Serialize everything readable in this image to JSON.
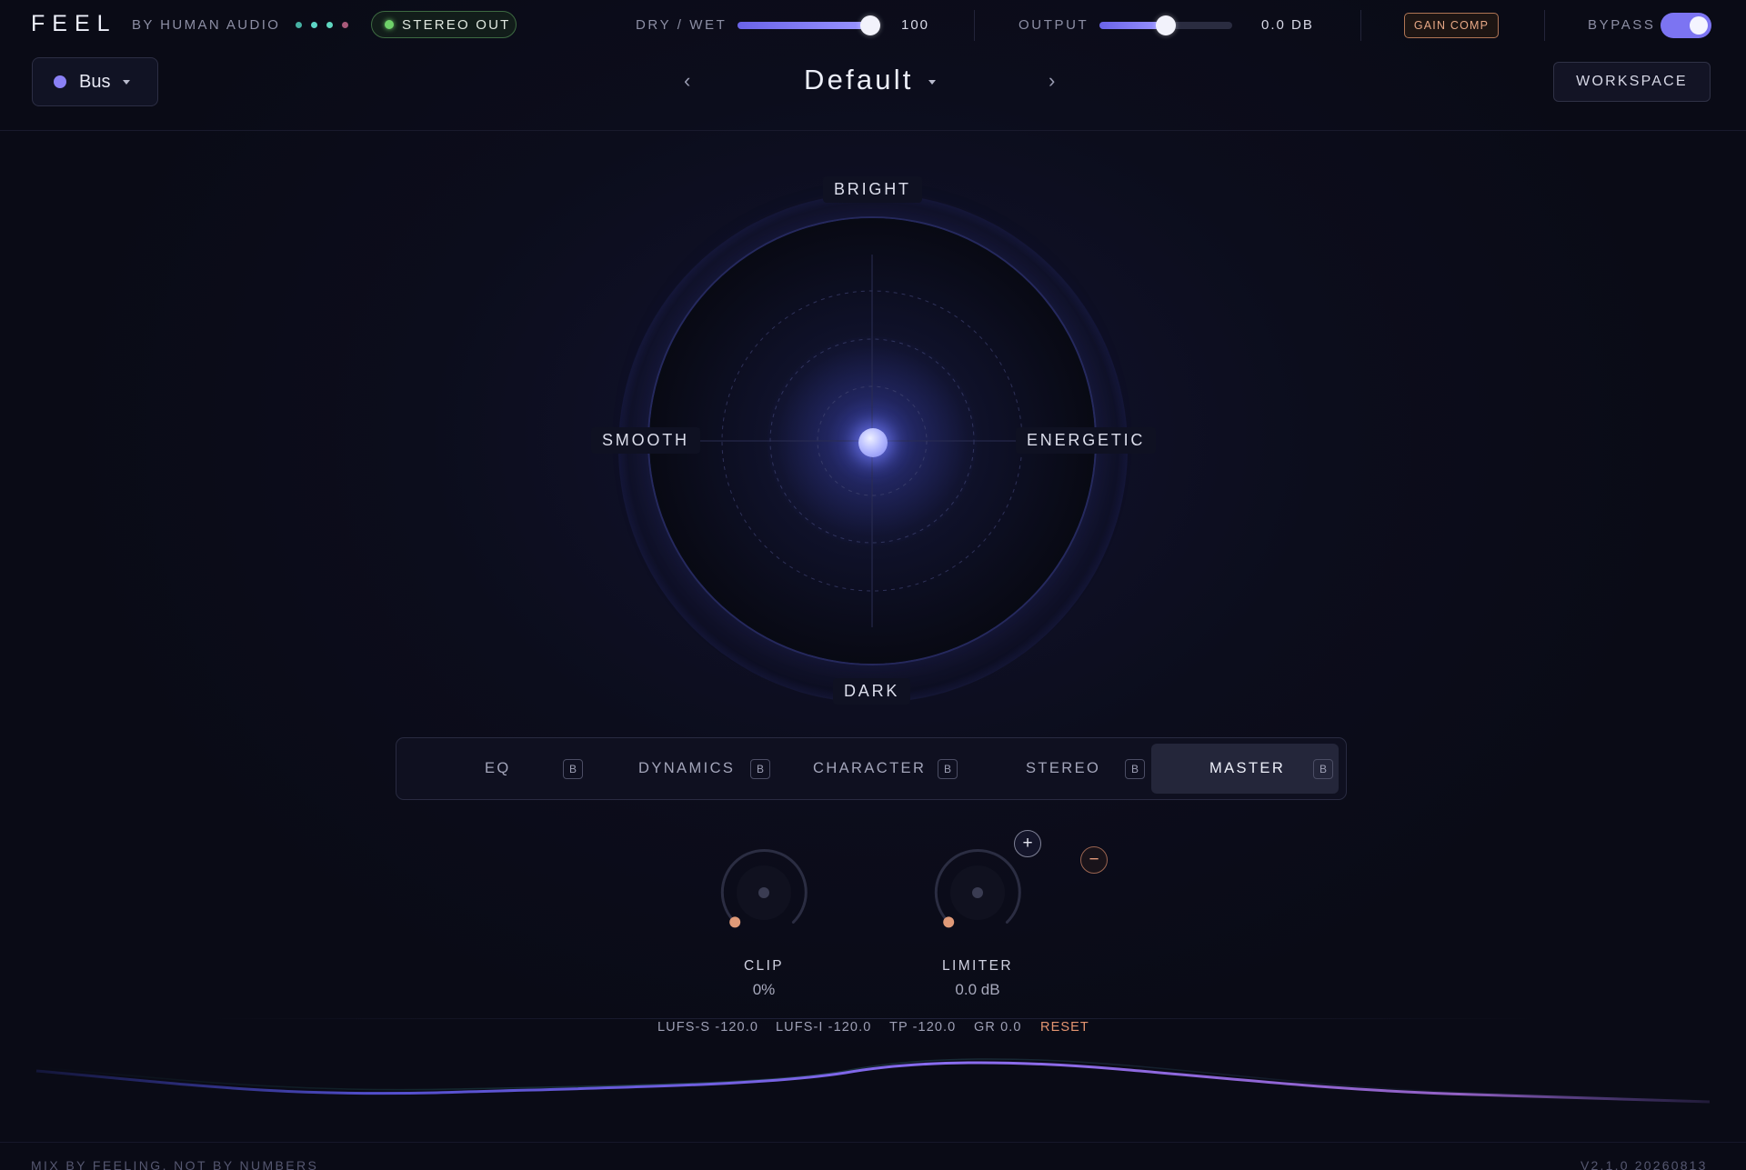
{
  "header": {
    "brand": "FEEL",
    "brand_sub": "BY HUMAN AUDIO",
    "status_dots": [
      "#46b0a2",
      "#5dd6c6",
      "#5fd6c0",
      "#a85a7a"
    ],
    "stereo_out_label": "STEREO OUT",
    "dry_wet_label": "DRY / WET",
    "dry_wet_value": "100",
    "dry_wet_fraction": 1.0,
    "output_label": "OUTPUT",
    "output_value": "0.0 DB",
    "output_fraction": 0.5,
    "gain_comp_label": "GAIN COMP",
    "bypass_label": "BYPASS",
    "bypass_on": true
  },
  "toolbar": {
    "bus_label": "Bus",
    "prev_symbol": "‹",
    "next_symbol": "›",
    "preset_name": "Default",
    "workspace_label": "WORKSPACE"
  },
  "pad": {
    "top_label": "BRIGHT",
    "bottom_label": "DARK",
    "left_label": "SMOOTH",
    "right_label": "ENERGETIC"
  },
  "tabs": [
    {
      "label": "EQ",
      "badge": "B",
      "active": false
    },
    {
      "label": "DYNAMICS",
      "badge": "B",
      "active": false
    },
    {
      "label": "CHARACTER",
      "badge": "B",
      "active": false
    },
    {
      "label": "STEREO",
      "badge": "B",
      "active": false
    },
    {
      "label": "MASTER",
      "badge": "B",
      "active": true
    }
  ],
  "master": {
    "clip_label": "CLIP",
    "clip_value": "0%",
    "limiter_label": "LIMITER",
    "limiter_value": "0.0 dB",
    "plus_symbol": "+",
    "minus_symbol": "−"
  },
  "meters": {
    "lufs_s": "LUFS-S -120.0",
    "lufs_i": "LUFS-I -120.0",
    "tp": "TP -120.0",
    "gr": "GR 0.0",
    "reset": "RESET"
  },
  "footer": {
    "tagline": "MIX BY FEELING, NOT BY NUMBERS",
    "version": "V2.1.0 20260813"
  },
  "colors": {
    "accent": "#7c74f2",
    "knob_dot": "#e09a78",
    "stereo_led": "#6fd26a"
  }
}
